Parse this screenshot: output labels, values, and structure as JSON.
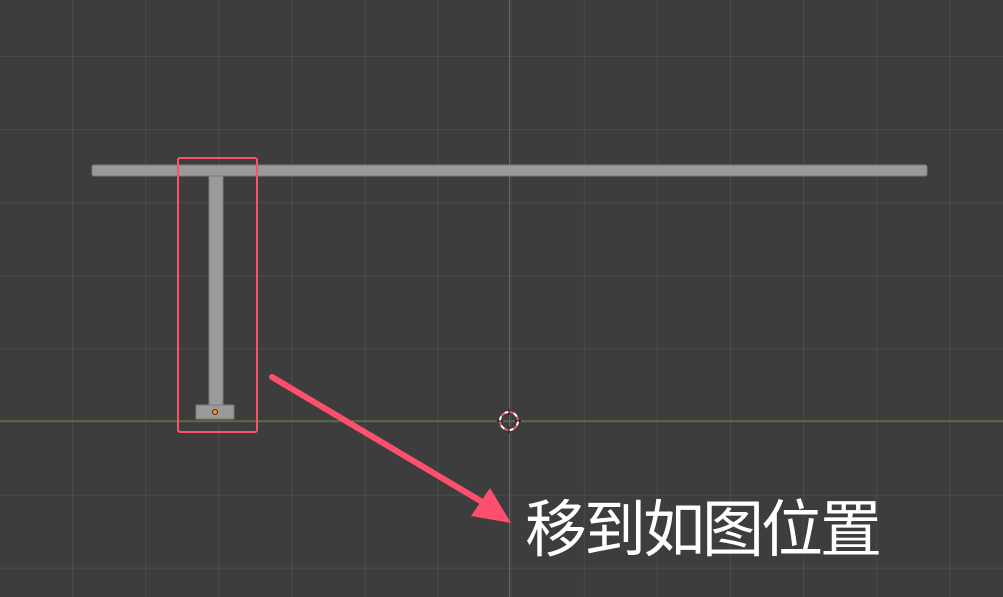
{
  "viewport": {
    "background": "#3d3d3d",
    "grid_color": "rgba(255,255,255,0.07)",
    "x_axis_color": "#6a8a3a",
    "z_axis_color": "#3f6f9b"
  },
  "scene": {
    "objects": [
      {
        "name": "table-top",
        "color": "#9a9a9a"
      },
      {
        "name": "table-leg",
        "color": "#9a9a9a",
        "selected": true,
        "origin_dot_color": "#ff8a00"
      }
    ],
    "cursor": "3d-cursor"
  },
  "annotation": {
    "text": "移到如图位置",
    "color": "#ffffff",
    "highlight_color": "#ff4f6e",
    "arrow_color": "#ff4f6e"
  }
}
